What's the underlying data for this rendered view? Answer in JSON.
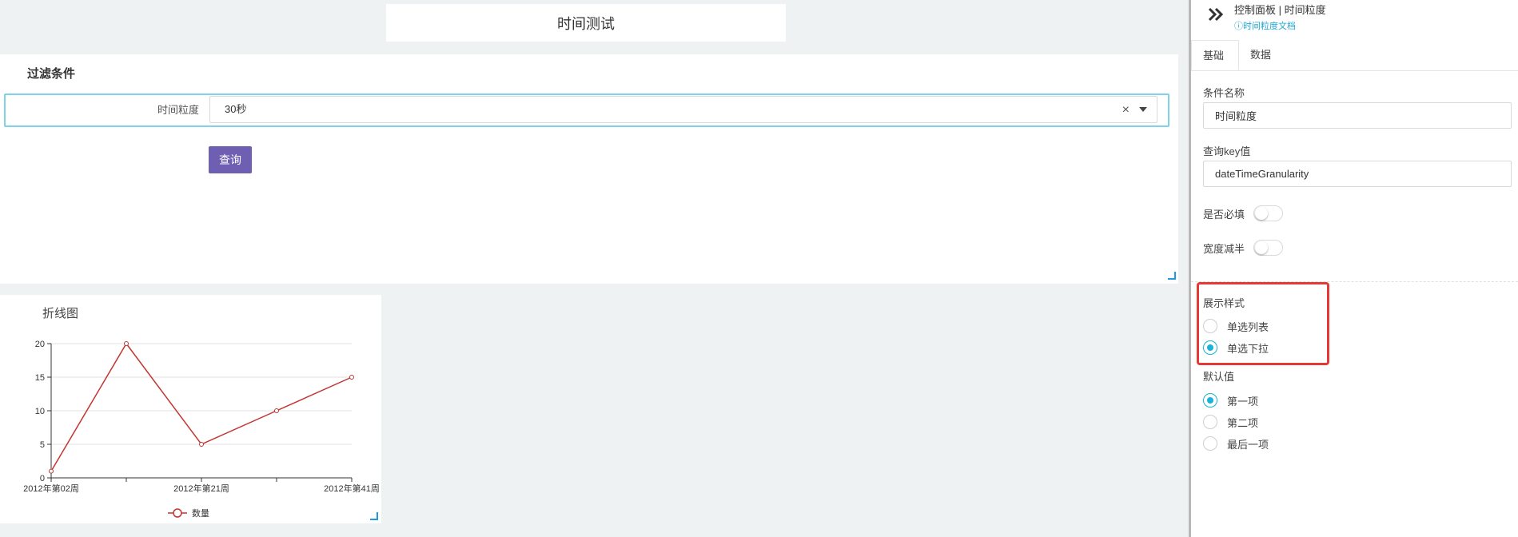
{
  "page": {
    "title": "时间测试"
  },
  "filter": {
    "title": "过滤条件",
    "label": "时间粒度",
    "selected": "30秒",
    "clear_icon": "×",
    "query_label": "查询"
  },
  "chart_data": {
    "type": "line",
    "title": "折线图",
    "x": [
      "2012年第02周",
      "",
      "2012年第21周",
      "",
      "2012年第41周"
    ],
    "tick_labels": [
      "2012年第02周",
      "2012年第21周",
      "2012年第41周"
    ],
    "series": [
      {
        "name": "数量",
        "values": [
          1,
          20,
          5,
          10,
          15
        ],
        "color": "#c23531"
      }
    ],
    "ylim": [
      0,
      20
    ],
    "yticks": [
      0,
      5,
      10,
      15,
      20
    ],
    "grid": true,
    "legend": "bottom-center"
  },
  "sidebar": {
    "title": "控制面板 | 时间粒度",
    "doc_link": "ⓘ时间粒度文档",
    "tabs": [
      {
        "label": "基础"
      },
      {
        "label": "数据"
      }
    ],
    "name_label": "条件名称",
    "name_value": "时间粒度",
    "key_label": "查询key值",
    "key_value": "dateTimeGranularity",
    "required_label": "是否必填",
    "half_width_label": "宽度减半",
    "display_style_label": "展示样式",
    "display_options": [
      "单选列表",
      "单选下拉"
    ],
    "default_label": "默认值",
    "default_options": [
      "第一项",
      "第二项",
      "最后一项"
    ]
  },
  "colors": {
    "accent": "#1ab2d6",
    "button": "#6f5fb2",
    "line": "#c23531",
    "highlight": "#e53935"
  }
}
